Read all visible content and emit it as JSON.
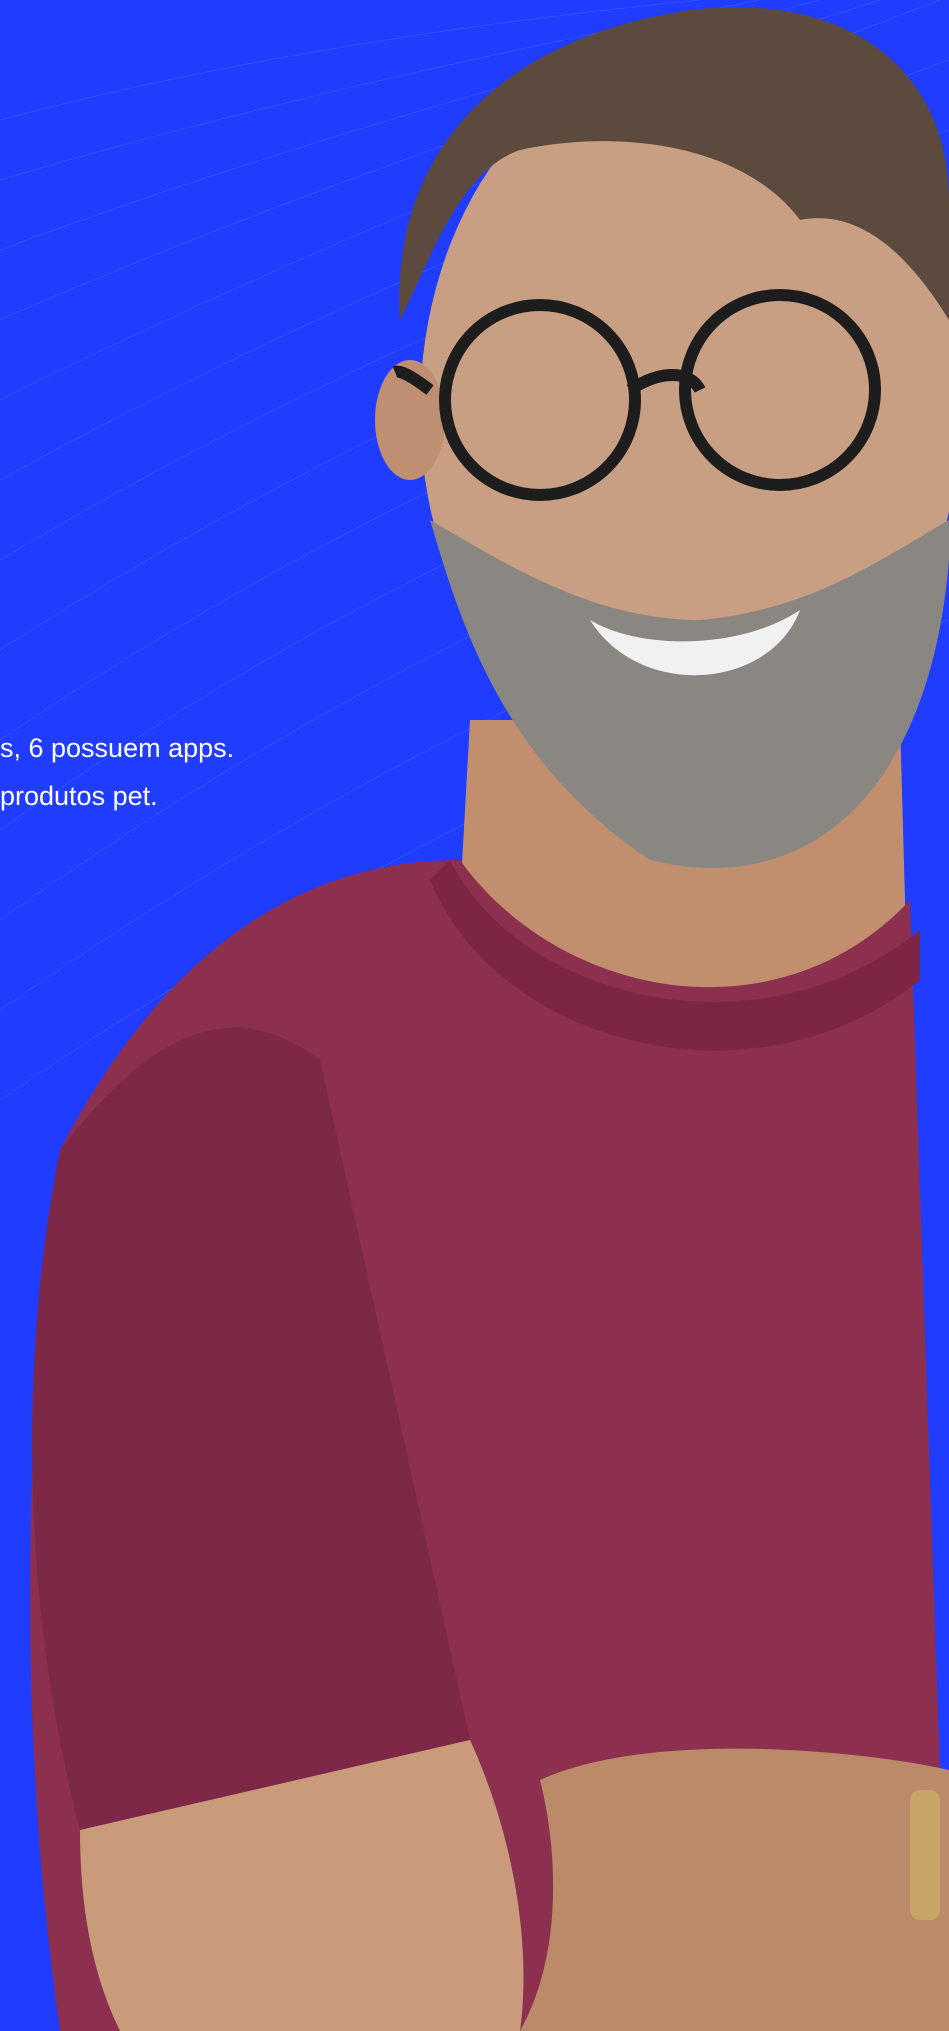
{
  "hero": {
    "lines": [
      "s, 6 possuem apps.",
      "produtos pet."
    ]
  },
  "colors": {
    "background": "#1f3cff",
    "shirt": "#8d2f4f",
    "skin": "#c89f82",
    "beard": "#8a8783",
    "text": "#ffffff"
  }
}
